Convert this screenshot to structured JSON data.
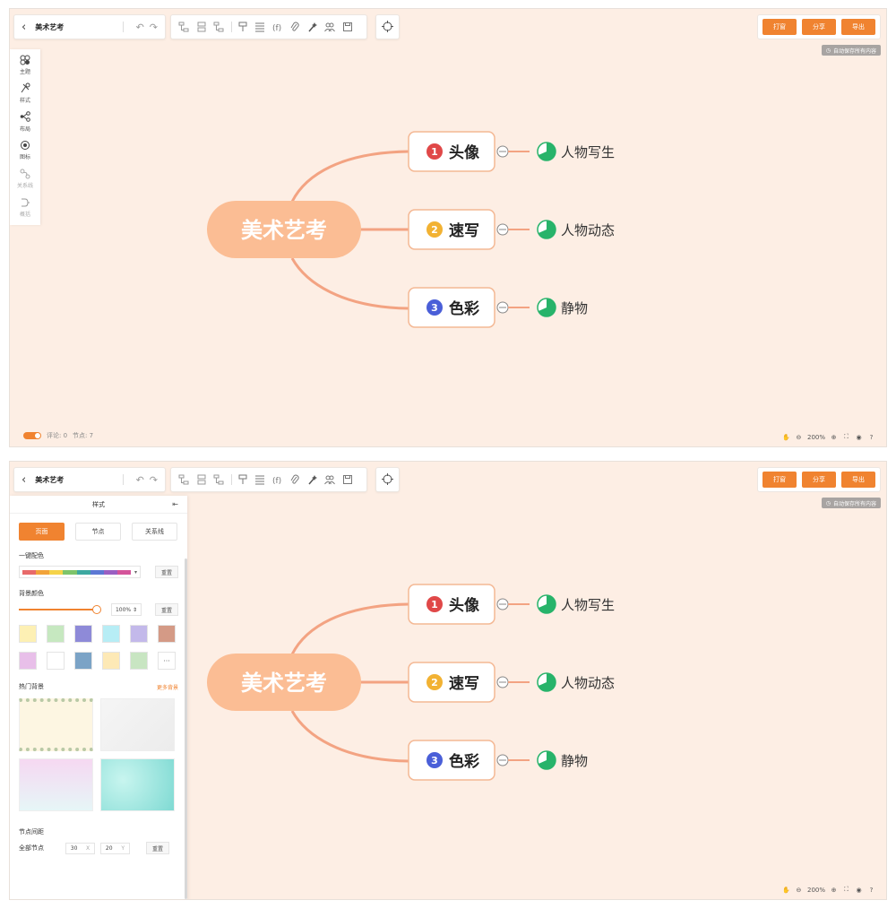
{
  "doc_title": "美术艺考",
  "buttons": {
    "print": "打窗",
    "share": "分享",
    "export": "导出"
  },
  "autosave": "自动保存所有内容",
  "sidebar": [
    {
      "label": "主题",
      "icon": "theme-icon"
    },
    {
      "label": "样式",
      "icon": "style-icon"
    },
    {
      "label": "布局",
      "icon": "layout-icon"
    },
    {
      "label": "图标",
      "icon": "icon-icon"
    },
    {
      "label": "关系线",
      "icon": "relation-line-icon"
    },
    {
      "label": "概括",
      "icon": "summary-icon"
    }
  ],
  "footer": {
    "comments": "评论: 0",
    "nodes": "节点: 7",
    "zoom": "200%"
  },
  "mindmap": {
    "root": "美术艺考",
    "branches": [
      {
        "num": "1",
        "label": "头像",
        "color": "#e04848",
        "child": "人物写生"
      },
      {
        "num": "2",
        "label": "速写",
        "color": "#f2b233",
        "child": "人物动态"
      },
      {
        "num": "3",
        "label": "色彩",
        "color": "#4a5fd8",
        "child": "静物"
      }
    ]
  },
  "panel": {
    "title": "样式",
    "tabs": [
      "页面",
      "节点",
      "关系线"
    ],
    "one_click_color": "一键配色",
    "reset": "重置",
    "bg_color": "背景颜色",
    "opacity": "100%",
    "hot_bg": "热门背景",
    "more_bg": "更多背景",
    "node_spacing": "节点间距",
    "all_nodes": "全部节点",
    "spacing_x": "30",
    "spacing_y": "20",
    "x_label": "X",
    "y_label": "Y",
    "swatches": [
      "#fdf0b4",
      "#c6e8c0",
      "#8e8ad8",
      "#b7edf5",
      "#c3b9ea",
      "#d49a86",
      "#e8bfe9",
      "#ffffff",
      "#7ba3c6",
      "#fde9b6",
      "#c8e5c2"
    ],
    "palette": [
      "#e86a6a",
      "#f2a33a",
      "#f5d349",
      "#7ec46a",
      "#3da8a0",
      "#5c78d4",
      "#9a5fc2",
      "#d4549a"
    ]
  }
}
